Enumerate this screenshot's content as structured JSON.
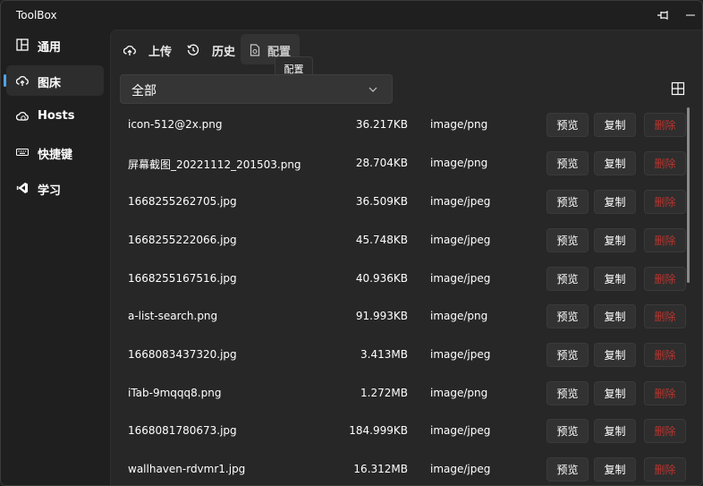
{
  "app": {
    "title": "ToolBox"
  },
  "titlebar": {
    "pin_icon": "pin-icon",
    "minimize_icon": "minimize-icon"
  },
  "sidebar": {
    "items": [
      {
        "label": "通用",
        "icon": "layout-icon",
        "active": false
      },
      {
        "label": "图床",
        "icon": "cloud-upload-icon",
        "active": true
      },
      {
        "label": "Hosts",
        "icon": "globe-cloud-icon",
        "active": false
      },
      {
        "label": "快捷键",
        "icon": "keyboard-icon",
        "active": false
      },
      {
        "label": "学习",
        "icon": "vscode-icon",
        "active": false
      }
    ]
  },
  "tabs": [
    {
      "label": "上传",
      "icon": "cloud-upload-icon",
      "active": false
    },
    {
      "label": "历史",
      "icon": "history-icon",
      "active": false
    },
    {
      "label": "配置",
      "icon": "settings-doc-icon",
      "active": true
    }
  ],
  "tooltip": {
    "text": "配置"
  },
  "filter": {
    "selected": "全部"
  },
  "buttons": {
    "preview": "预览",
    "copy": "复制",
    "delete": "删除"
  },
  "files": [
    {
      "name": "icon-512@2x.png",
      "size": "36.217KB",
      "type": "image/png"
    },
    {
      "name": "屏幕截图_20221112_201503.png",
      "size": "28.704KB",
      "type": "image/png"
    },
    {
      "name": "1668255262705.jpg",
      "size": "36.509KB",
      "type": "image/jpeg"
    },
    {
      "name": "1668255222066.jpg",
      "size": "45.748KB",
      "type": "image/jpeg"
    },
    {
      "name": "1668255167516.jpg",
      "size": "40.936KB",
      "type": "image/jpeg"
    },
    {
      "name": "a-list-search.png",
      "size": "91.993KB",
      "type": "image/png"
    },
    {
      "name": "1668083437320.jpg",
      "size": "3.413MB",
      "type": "image/jpeg"
    },
    {
      "name": "iTab-9mqqq8.png",
      "size": "1.272MB",
      "type": "image/png"
    },
    {
      "name": "1668081780673.jpg",
      "size": "184.999KB",
      "type": "image/jpeg"
    },
    {
      "name": "wallhaven-rdvmr1.jpg",
      "size": "16.312MB",
      "type": "image/jpeg"
    }
  ],
  "colors": {
    "accent": "#4fa3e8",
    "danger": "#b8352f",
    "background": "#1f1f1f",
    "panel": "#272727"
  }
}
